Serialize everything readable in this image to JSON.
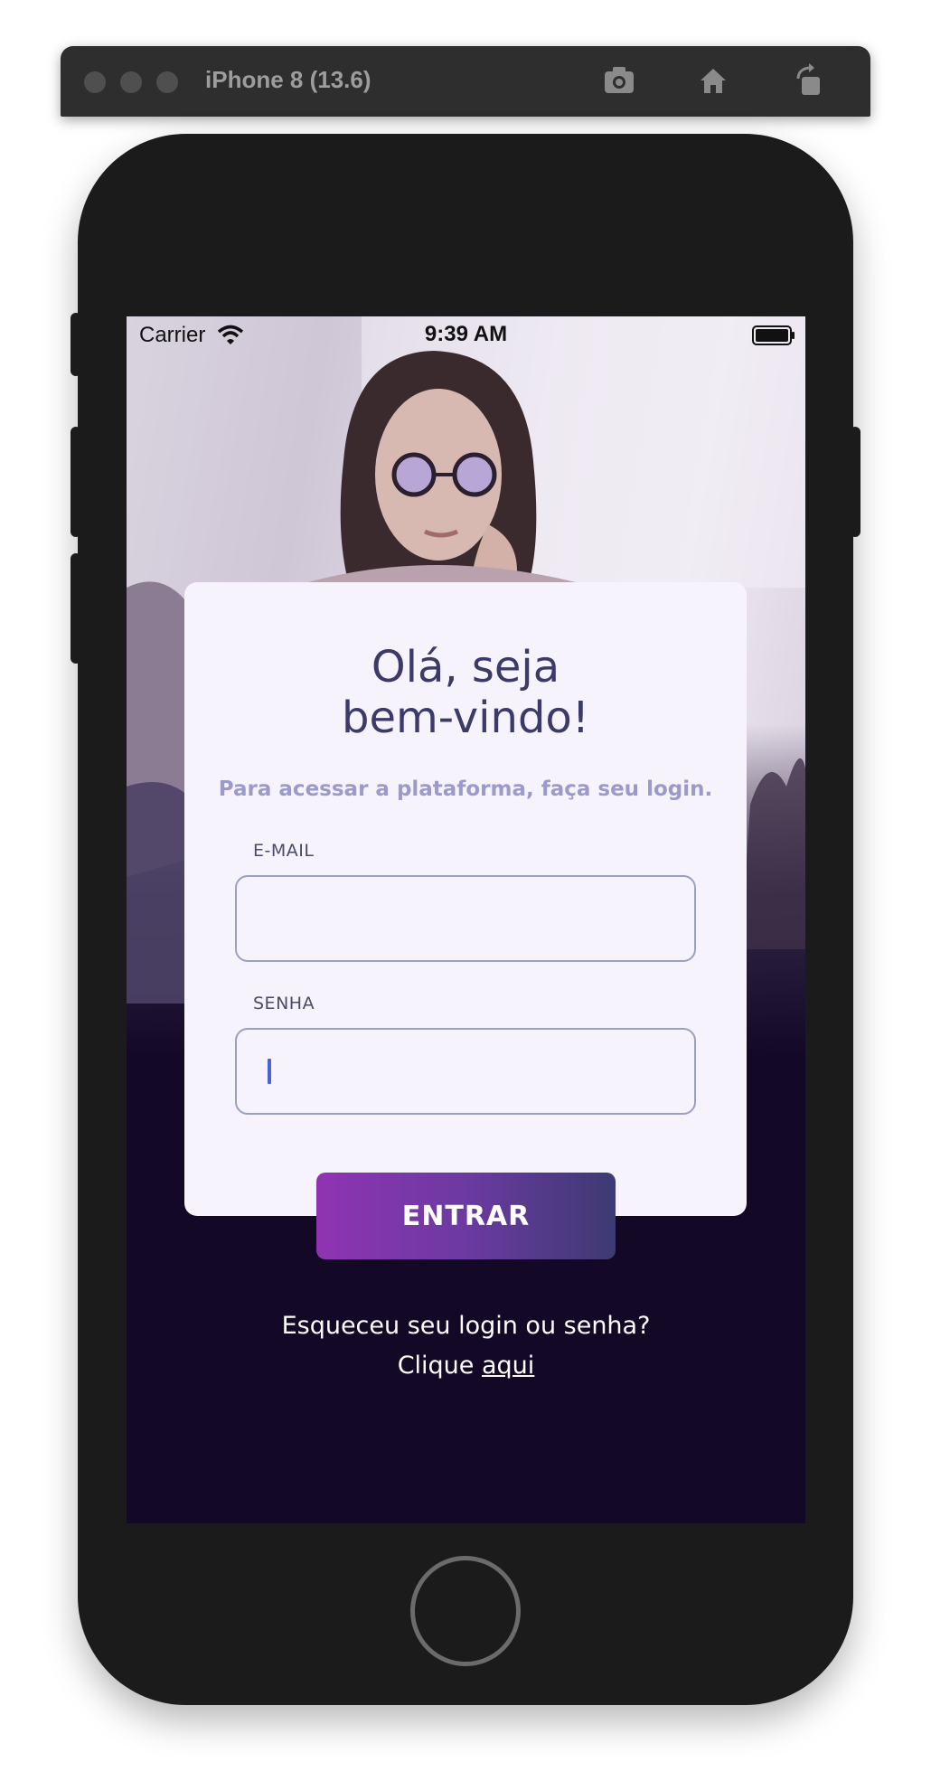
{
  "simulator": {
    "title": "iPhone 8 (13.6)",
    "tools": [
      "screenshot-icon",
      "home-icon",
      "rotate-icon"
    ]
  },
  "status_bar": {
    "carrier": "Carrier",
    "time": "9:39 AM"
  },
  "login": {
    "heading_line1": "Olá, seja",
    "heading_line2": "bem-vindo!",
    "subtitle": "Para acessar a plataforma, faça seu login.",
    "email_label": "E-MAIL",
    "email_value": "",
    "password_label": "SENHA",
    "password_value": "",
    "submit_label": "ENTRAR",
    "forgot_line1": "Esqueceu seu login ou senha?",
    "forgot_prefix": "Clique",
    "forgot_link": "aqui"
  },
  "colors": {
    "card_bg": "#f6f3fc",
    "heading": "#3c3a6a",
    "subtitle": "#9a9acb",
    "button_start": "#9033b3",
    "button_end": "#3d3a72",
    "screen_bg": "#130826"
  }
}
